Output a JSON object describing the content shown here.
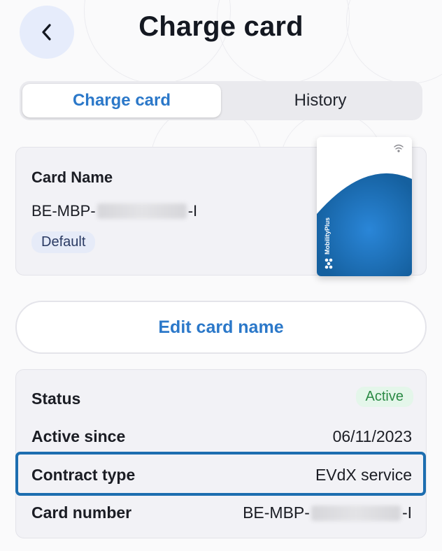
{
  "header": {
    "title": "Charge card",
    "back_icon": "chevron-left-icon"
  },
  "tabs": [
    {
      "label": "Charge card",
      "active": true
    },
    {
      "label": "History",
      "active": false
    }
  ],
  "card": {
    "name_label": "Card Name",
    "name_prefix": "BE-MBP-",
    "name_suffix": "-I",
    "default_badge": "Default",
    "image": {
      "brand": "MobilityPlus",
      "primary_color": "#1f6fb8",
      "contactless_icon": "wifi-icon"
    }
  },
  "edit_button": {
    "label": "Edit card name"
  },
  "details": {
    "status": {
      "label": "Status",
      "value": "Active"
    },
    "active_since": {
      "label": "Active since",
      "value": "06/11/2023"
    },
    "contract_type": {
      "label": "Contract type",
      "value": "EVdX service"
    },
    "card_number": {
      "label": "Card number",
      "prefix": "BE-MBP-",
      "suffix": "-I"
    }
  },
  "colors": {
    "accent": "#2b78c9",
    "highlight": "#1d6eb0",
    "active_green": "#2b8a45"
  }
}
